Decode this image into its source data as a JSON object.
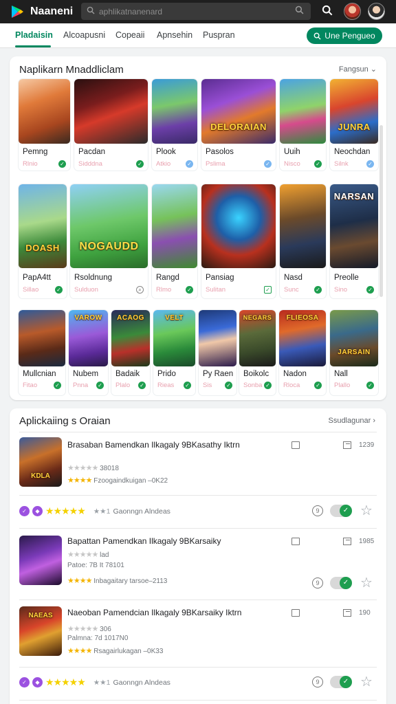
{
  "app": {
    "title": "Naaneni",
    "search_placeholder": "aphlikatnanenard"
  },
  "tabs": [
    "Pladaisin",
    "Alcoapusni",
    "Copeaii",
    "Apnsehin",
    "Puspran"
  ],
  "cta_label": "Une Pengueo",
  "section1": {
    "title": "Naplikarn Mnaddliclam",
    "sort_label": "Fangsun",
    "rows": [
      [
        {
          "name": "Pemng",
          "sub": "Rlnio",
          "cap": ""
        },
        {
          "name": "Pacdan",
          "sub": "Sidddna",
          "cap": ""
        },
        {
          "name": "Plook",
          "sub": "Atkio",
          "cap": ""
        },
        {
          "name": "Pasolos",
          "sub": "Pslima",
          "cap": "DELORAIAN"
        },
        {
          "name": "Uuih",
          "sub": "Nisco",
          "cap": ""
        },
        {
          "name": "Neochdan",
          "sub": "Silnk",
          "cap": "JUNRA"
        }
      ],
      [
        {
          "name": "PapA4tt",
          "sub": "Sillao",
          "cap": "DOASH"
        },
        {
          "name": "Rsoldnung",
          "sub": "Sulduon",
          "cap": "NOGAUDD"
        },
        {
          "name": "Rangd",
          "sub": "Rlmo",
          "cap": ""
        },
        {
          "name": "Pansiag",
          "sub": "Sulitan",
          "cap": ""
        },
        {
          "name": "Nasd",
          "sub": "Sunc",
          "cap": ""
        },
        {
          "name": "Preolle",
          "sub": "Sino",
          "cap": "NARSAN"
        }
      ],
      [
        {
          "name": "Mullcnian",
          "sub": "Fitao",
          "cap": ""
        },
        {
          "name": "Nubem",
          "sub": "Pnna",
          "cap": "VAROW"
        },
        {
          "name": "Badaik",
          "sub": "Plalo",
          "cap": "ACAOG"
        },
        {
          "name": "Prido",
          "sub": "Rieas",
          "cap": "VELT"
        },
        {
          "name": "Py Raen",
          "sub": "Sis",
          "cap": ""
        },
        {
          "name": "Boikolc",
          "sub": "Sonba",
          "cap": "NEGARS"
        },
        {
          "name": "Nadon",
          "sub": "Rloca",
          "cap": "FLIEOSA"
        },
        {
          "name": "Nall",
          "sub": "Plallo",
          "cap": "JARSAIN"
        }
      ]
    ]
  },
  "section2": {
    "title": "Aplickaiing s Oraian",
    "more_label": "Ssudlagunar",
    "items": [
      {
        "title": "Brasaban Bamendkan Ilkagaly 9BKasathy Iktrn",
        "meta1": "38018",
        "meta2": "Fzoogaindkuigan –0K22",
        "count": "1239",
        "cap": "KDLA",
        "footer_text": "Gaonngn Alndeas"
      },
      {
        "title": "Bapattan Pamendkan Ilkagaly 9BKarsaiky",
        "meta1": "lad",
        "meta2": "Patoe: 7B It 78101",
        "meta3": "Inbagaitary tarsoe–2113",
        "count": "1985",
        "cap": ""
      },
      {
        "title": "Naeoban Pamendcian Ilkagaly 9BKarsaiky Iktrn",
        "meta1": "306",
        "meta2": "Palmna: 7d 1017N0",
        "meta3": "Rsagairlukagan –0K33",
        "count": "190",
        "cap": "NAEAS",
        "footer_text": "Gaonngn Alndeas"
      }
    ]
  }
}
